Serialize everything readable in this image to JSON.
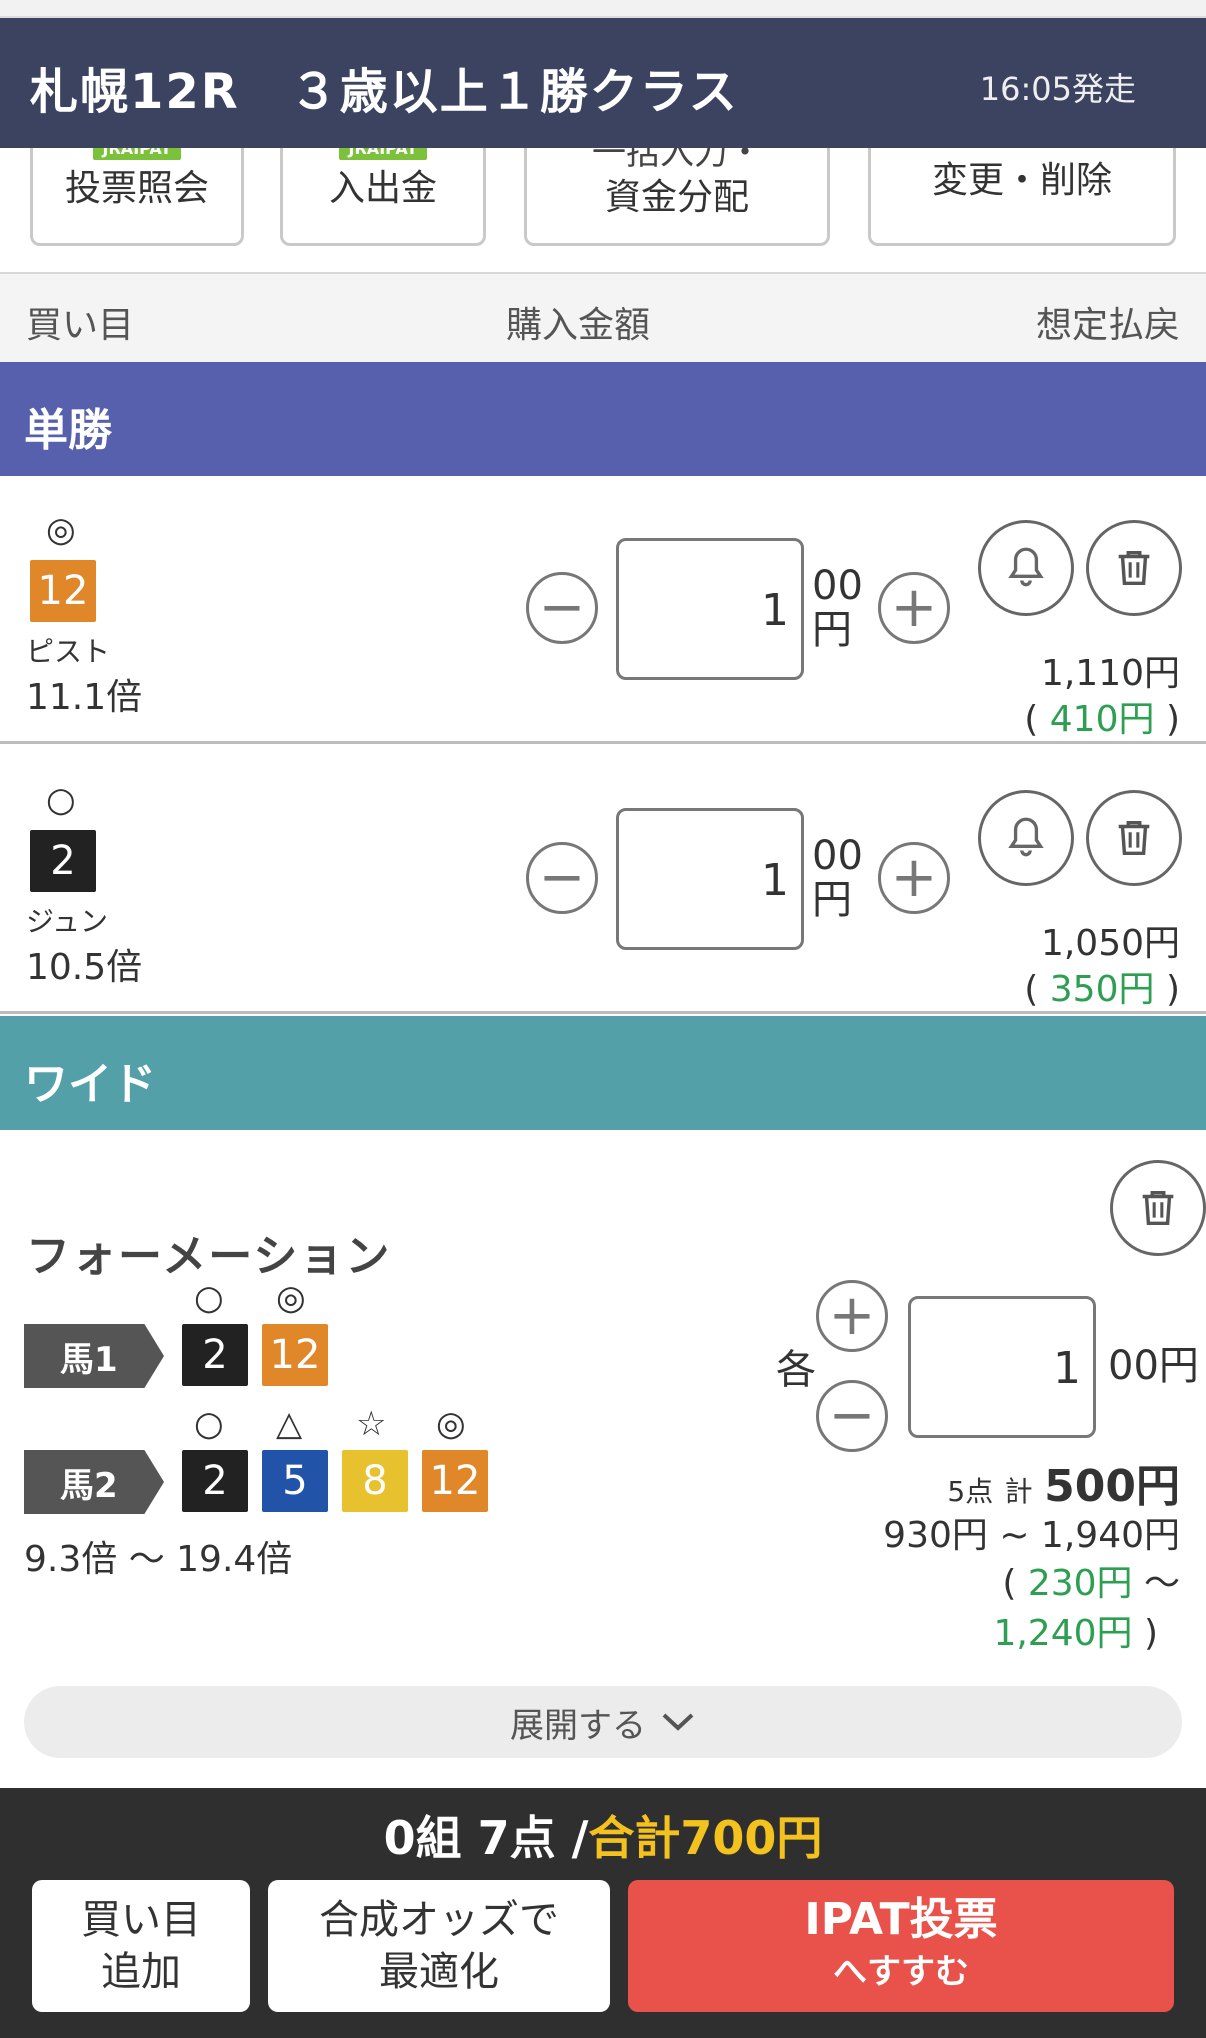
{
  "header": {
    "title": "札幌12R　３歳以上１勝クラス",
    "start_time": "16:05発走"
  },
  "top_buttons": [
    {
      "tag": "JRAIPAT",
      "label": "投票照会"
    },
    {
      "tag": "JRAIPAT",
      "label": "入出金"
    },
    {
      "label_line1": "一括入力・",
      "label_line2": "資金分配"
    },
    {
      "label": "変更・削除"
    }
  ],
  "columns": {
    "col1": "買い目",
    "col2": "購入金額",
    "col3": "想定払戻"
  },
  "sections": {
    "tansho": {
      "title": "単勝",
      "color": "#5760ad"
    },
    "wide": {
      "title": "ワイド",
      "color": "#53a0a8"
    }
  },
  "bets": [
    {
      "mark": "◎",
      "number": "12",
      "num_color": "#e0872a",
      "name": "ピスト",
      "odds": "11.1倍",
      "amount": "1",
      "unit_top": "00",
      "unit_bottom": "円",
      "payout": "1,110円",
      "profit_open": "(",
      "profit": "410円",
      "profit_close": ")"
    },
    {
      "mark": "○",
      "number": "2",
      "num_color": "#222222",
      "name": "ジュン",
      "odds": "10.5倍",
      "amount": "1",
      "unit_top": "00",
      "unit_bottom": "円",
      "payout": "1,050円",
      "profit_open": "(",
      "profit": "350円",
      "profit_close": ")"
    }
  ],
  "formation": {
    "title": "フォーメーション",
    "horse1": {
      "label": "馬1",
      "entries": [
        {
          "mark": "○",
          "number": "2",
          "color": "#222222"
        },
        {
          "mark": "◎",
          "number": "12",
          "color": "#e0872a"
        }
      ]
    },
    "horse2": {
      "label": "馬2",
      "entries": [
        {
          "mark": "○",
          "number": "2",
          "color": "#222222"
        },
        {
          "mark": "△",
          "number": "5",
          "color": "#2153a8"
        },
        {
          "mark": "☆",
          "number": "8",
          "color": "#e8c22e"
        },
        {
          "mark": "◎",
          "number": "12",
          "color": "#e0872a"
        }
      ]
    },
    "odds_range": "9.3倍 〜 19.4倍",
    "each_label": "各",
    "amount": "1",
    "unit": "00円",
    "points": "5点",
    "total_label": "計",
    "total": "500円",
    "payout_range": "930円 ~ 1,940円",
    "profit_open": "(",
    "profit_from": "230円",
    "profit_tilde": "〜",
    "profit_to": "1,240円",
    "profit_close": ")"
  },
  "expand_label": "展開する",
  "footer": {
    "summary_left": "0組 7点 /",
    "summary_total": "合計700円",
    "add_line1": "買い目",
    "add_line2": "追加",
    "opt_line1": "合成オッズで",
    "opt_line2": "最適化",
    "ipat_line1": "IPAT投票",
    "ipat_line2": "へすすむ"
  }
}
